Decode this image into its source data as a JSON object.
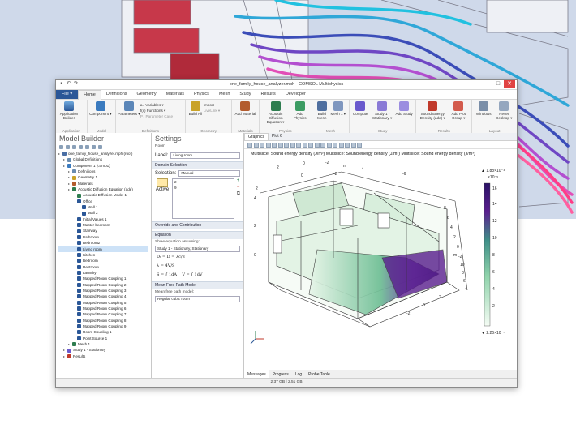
{
  "window": {
    "title": "one_family_house_analyzer.mph - COMSOL Multiphysics"
  },
  "menu": {
    "file": "File ▾",
    "items": [
      "Home",
      "Definitions",
      "Geometry",
      "Materials",
      "Physics",
      "Mesh",
      "Study",
      "Results",
      "Developer"
    ],
    "active_index": 0
  },
  "ribbon": {
    "groups": [
      {
        "label": "Application",
        "buttons": [
          "Application Builder"
        ]
      },
      {
        "label": "Model",
        "buttons": [
          "Component ▾",
          "Add Component ▾"
        ]
      },
      {
        "label": "Definitions",
        "buttons": [
          "Parameters ▾"
        ],
        "small": [
          "a= Variables ▾",
          "f(x) Functions ▾",
          "P↓ Parameter Case"
        ]
      },
      {
        "label": "Geometry",
        "buttons": [
          "Build All"
        ],
        "small": [
          "Import",
          "LiveLink ▾"
        ]
      },
      {
        "label": "Materials",
        "buttons": [
          "Add Material"
        ]
      },
      {
        "label": "Physics",
        "buttons": [
          "Acoustic Diffusion Equation ▾",
          "Add Physics"
        ]
      },
      {
        "label": "Mesh",
        "buttons": [
          "Build Mesh",
          "Mesh 1 ▾"
        ]
      },
      {
        "label": "Study",
        "buttons": [
          "Compute",
          "Study 1 - Stationary ▾",
          "Add Study"
        ]
      },
      {
        "label": "Results",
        "buttons": [
          "Sound Energy Density (ade) ▾",
          "Add Plot Group ▾"
        ]
      },
      {
        "label": "Layout",
        "buttons": [
          "Windows",
          "Reset Desktop ▾"
        ]
      }
    ]
  },
  "model_builder": {
    "title": "Model Builder",
    "tree": [
      {
        "label": "one_family_house_analyzer.mph (root)",
        "depth": 0,
        "color": "#4a6fa5"
      },
      {
        "label": "Global Definitions",
        "depth": 1,
        "color": "#6a8caf"
      },
      {
        "label": "Component 1 (comp1)",
        "depth": 1,
        "color": "#3b7bbf"
      },
      {
        "label": "Definitions",
        "depth": 2,
        "color": "#6a8caf"
      },
      {
        "label": "Geometry 1",
        "depth": 2,
        "color": "#c9a227"
      },
      {
        "label": "Materials",
        "depth": 2,
        "color": "#b35c2e"
      },
      {
        "label": "Acoustic Diffusion Equation (ade)",
        "depth": 2,
        "color": "#2e7d4f"
      },
      {
        "label": "Acoustic Diffusion Model 1",
        "depth": 3,
        "color": "#2e7d4f"
      },
      {
        "label": "Office",
        "depth": 3,
        "color": "#2b5797"
      },
      {
        "label": "Wall 1",
        "depth": 4,
        "color": "#2b5797"
      },
      {
        "label": "Wall 2",
        "depth": 4,
        "color": "#2b5797"
      },
      {
        "label": "Initial Values 1",
        "depth": 3,
        "color": "#2b5797"
      },
      {
        "label": "Master bedroom",
        "depth": 3,
        "color": "#2b5797"
      },
      {
        "label": "Stairway",
        "depth": 3,
        "color": "#2b5797"
      },
      {
        "label": "Bathroom",
        "depth": 3,
        "color": "#2b5797"
      },
      {
        "label": "Bedroom2",
        "depth": 3,
        "color": "#2b5797"
      },
      {
        "label": "Living room",
        "depth": 3,
        "color": "#2b5797",
        "selected": true
      },
      {
        "label": "Kitchen",
        "depth": 3,
        "color": "#2b5797"
      },
      {
        "label": "Bedroom",
        "depth": 3,
        "color": "#2b5797"
      },
      {
        "label": "Restroom",
        "depth": 3,
        "color": "#2b5797"
      },
      {
        "label": "Laundry",
        "depth": 3,
        "color": "#2b5797"
      },
      {
        "label": "Mapped Room Coupling 1",
        "depth": 3,
        "color": "#2b5797"
      },
      {
        "label": "Mapped Room Coupling 2",
        "depth": 3,
        "color": "#2b5797"
      },
      {
        "label": "Mapped Room Coupling 3",
        "depth": 3,
        "color": "#2b5797"
      },
      {
        "label": "Mapped Room Coupling 4",
        "depth": 3,
        "color": "#2b5797"
      },
      {
        "label": "Mapped Room Coupling 5",
        "depth": 3,
        "color": "#2b5797"
      },
      {
        "label": "Mapped Room Coupling 6",
        "depth": 3,
        "color": "#2b5797"
      },
      {
        "label": "Mapped Room Coupling 7",
        "depth": 3,
        "color": "#2b5797"
      },
      {
        "label": "Mapped Room Coupling 8",
        "depth": 3,
        "color": "#2b5797"
      },
      {
        "label": "Mapped Room Coupling 9",
        "depth": 3,
        "color": "#2b5797"
      },
      {
        "label": "Room Coupling 1",
        "depth": 3,
        "color": "#2b5797"
      },
      {
        "label": "Point Source 1",
        "depth": 3,
        "color": "#2b5797"
      },
      {
        "label": "Mesh 1",
        "depth": 2,
        "color": "#2e7d4f"
      },
      {
        "label": "Study 1 - Stationary",
        "depth": 1,
        "color": "#6a5acd"
      },
      {
        "label": "Results",
        "depth": 1,
        "color": "#c0392b"
      }
    ]
  },
  "settings": {
    "title": "Settings",
    "subtitle": "Room",
    "label_caption": "Label:",
    "label_value": "Living room",
    "domain_selection": "Domain Selection",
    "selection_caption": "Selection:",
    "selection_value": "Manual",
    "selection_items": [
      "2",
      "9"
    ],
    "active": "Active",
    "override": "Override and Contribution",
    "equation": "Equation",
    "show_eq": "Show equation assuming:",
    "study_value": "Study 1 - Stationary, Stationary",
    "eq1": "Dₜ = D = λc/3",
    "eq2": "λ = 4V/S",
    "eq3": "S = ∫ 1dA",
    "eq4": "V = ∫ 1dV",
    "mfp": "Mean Free Path Model",
    "mfp_caption": "Mean free path model:",
    "mfp_value": "Regular cubic room"
  },
  "graphics": {
    "tabs": [
      "Graphics",
      "Plot 6"
    ],
    "title": "Multislice: Sound energy density (J/m³)  Multislice: Sound energy density (J/m³)  Multislice: Sound energy density (J/m³)",
    "colorbar_max": "▲ 1.88×10⁻⁴",
    "colorbar_exp": "×10⁻⁵",
    "colorbar_min": "▼ 2.26×10⁻⁷",
    "colorbar_ticks": [
      "16",
      "14",
      "12",
      "10",
      "8",
      "6",
      "4",
      "2"
    ],
    "axis_labels": [
      "2",
      "0",
      "-2",
      "-4",
      "-6",
      "2",
      "0",
      "-2",
      "4",
      "2",
      "0",
      "8",
      "6",
      "4",
      "2",
      "0",
      "-2",
      "10",
      "8",
      "6",
      "4",
      "2",
      "0",
      "-2",
      "m",
      "m"
    ],
    "colors": {
      "low": "#f2fbf2",
      "mid": "#6fbf95",
      "high": "#5a1f8f",
      "top": "#2a1266"
    }
  },
  "bottom_tabs": [
    "Messages",
    "Progress",
    "Log",
    "Probe Table"
  ],
  "status": "2.37 GB | 2.51 GB"
}
